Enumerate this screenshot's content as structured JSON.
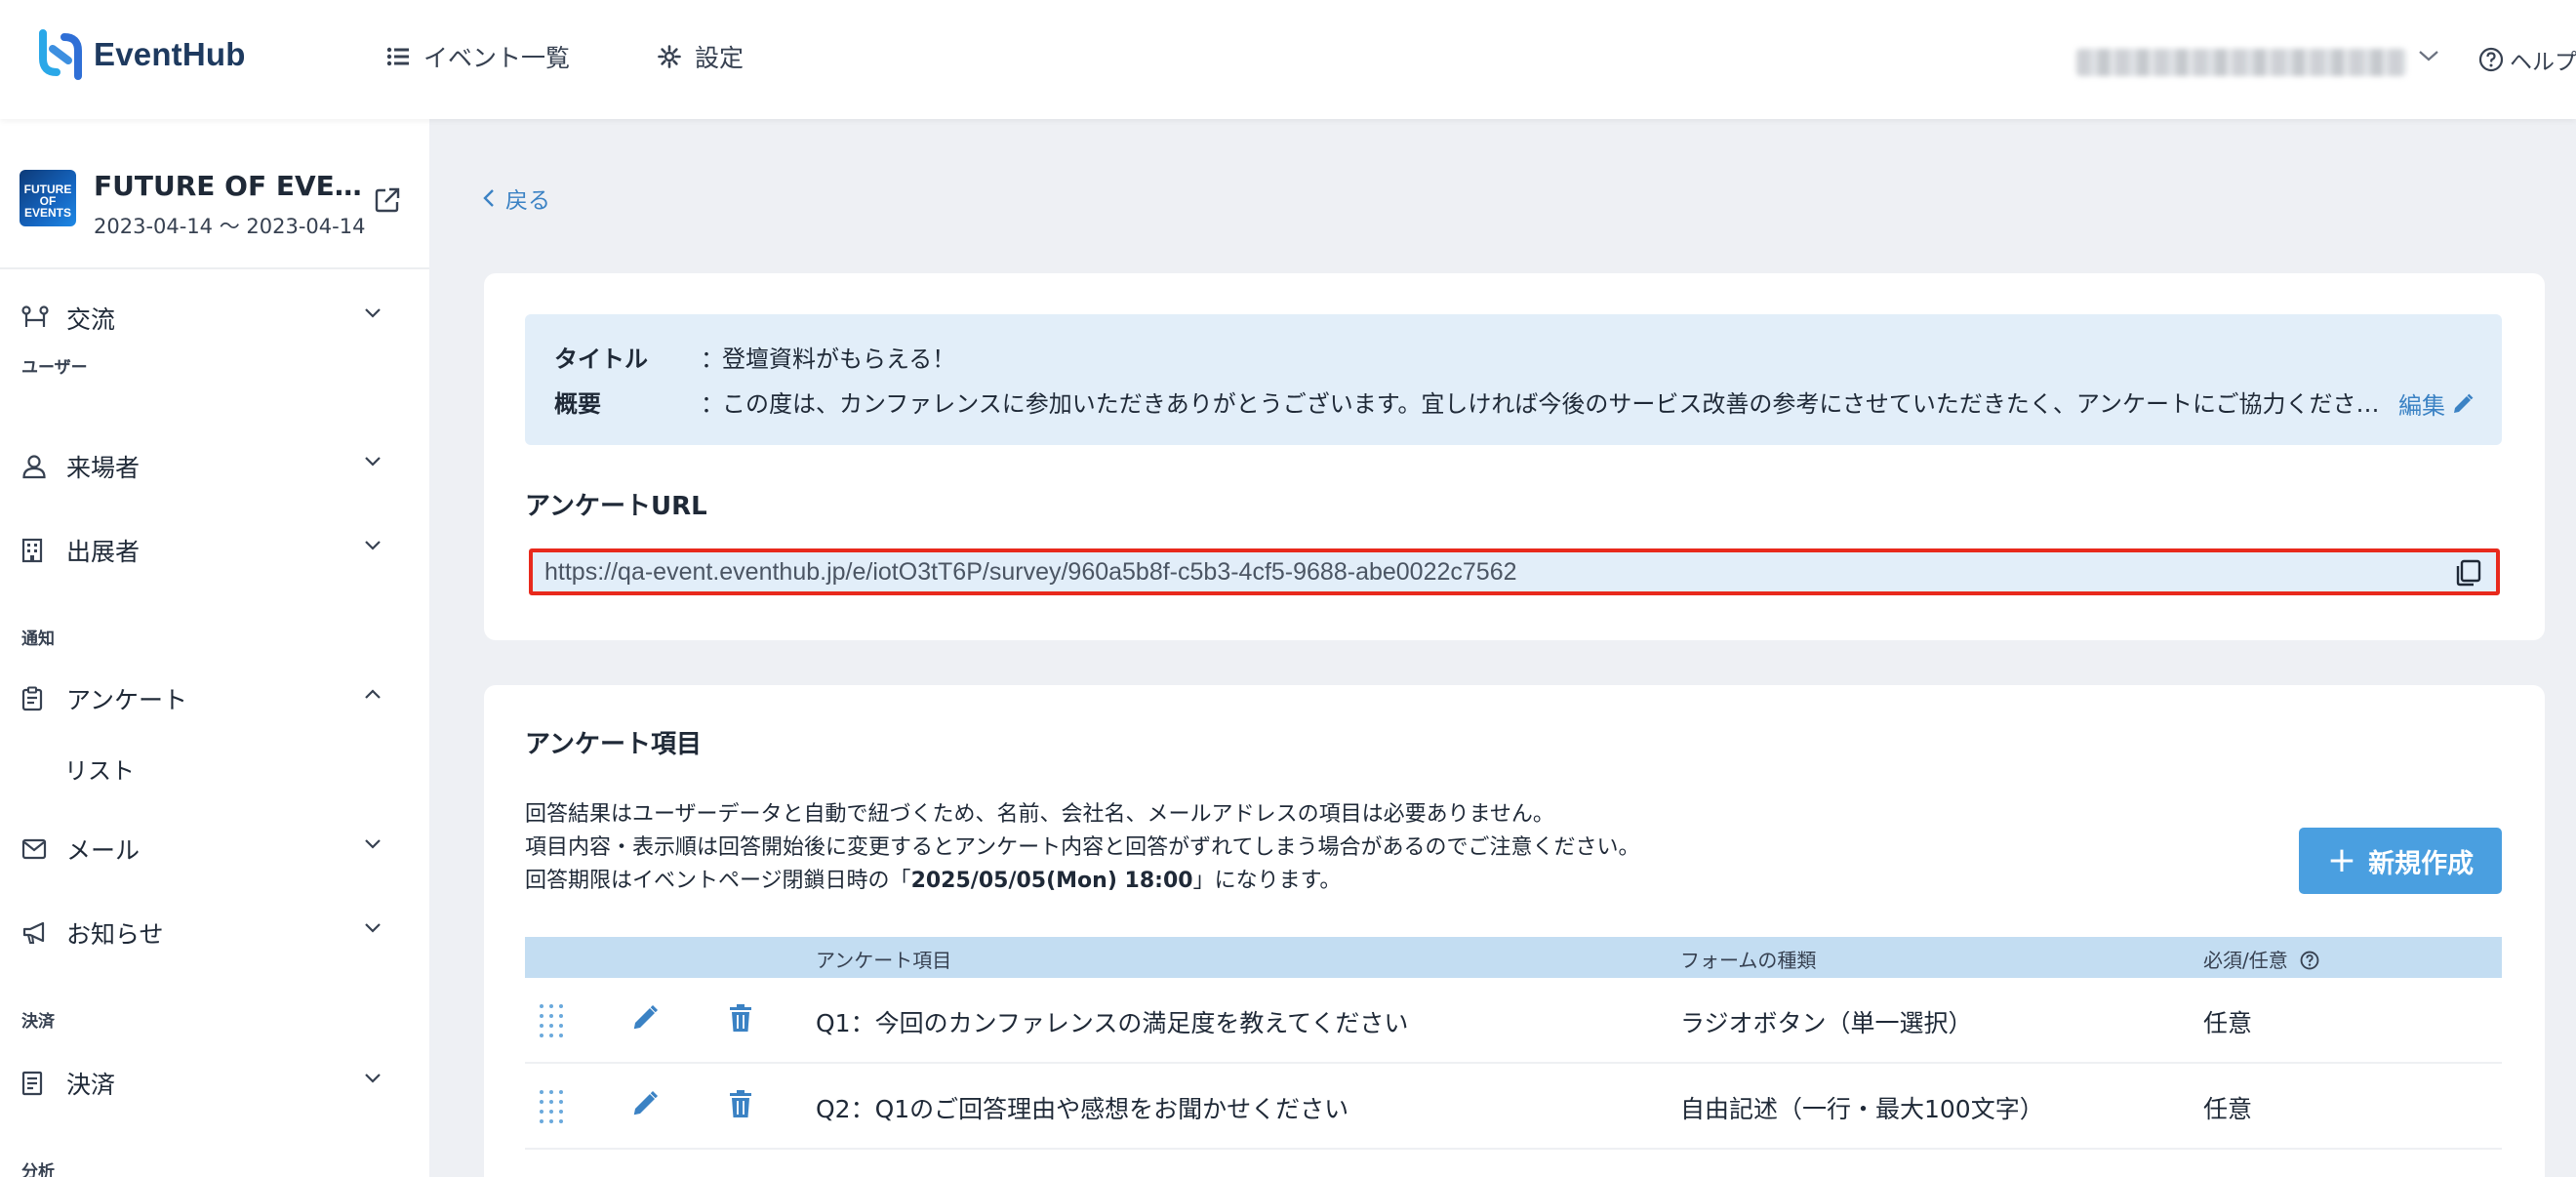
{
  "header": {
    "logo_text": "EventHub",
    "nav": [
      {
        "label": "イベント一覧",
        "icon": "list-icon"
      },
      {
        "label": "設定",
        "icon": "gear-icon"
      }
    ],
    "help_label": "ヘルプ"
  },
  "sidebar": {
    "event": {
      "thumb_text": "FUTURE OF EVENTS",
      "title": "FUTURE OF EVENTS",
      "dates": "2023-04-14 〜 2023-04-14"
    },
    "items": [
      {
        "label": "交流",
        "icon": "network-icon",
        "expanded": false
      },
      {
        "section": "ユーザー"
      },
      {
        "label": "来場者",
        "icon": "person-icon",
        "expanded": false
      },
      {
        "label": "出展者",
        "icon": "building-icon",
        "expanded": false
      },
      {
        "section": "通知"
      },
      {
        "label": "アンケート",
        "icon": "clipboard-icon",
        "expanded": true,
        "sub": [
          "リスト"
        ]
      },
      {
        "label": "メール",
        "icon": "mail-icon",
        "expanded": false
      },
      {
        "label": "お知らせ",
        "icon": "megaphone-icon",
        "expanded": false
      },
      {
        "section": "決済"
      },
      {
        "label": "決済",
        "icon": "receipt-icon",
        "expanded": false
      },
      {
        "section": "分析"
      }
    ]
  },
  "main": {
    "back_label": "戻る",
    "survey": {
      "title_key": "タイトル",
      "title_value": "登壇資料がもらえる！",
      "summary_key": "概要",
      "summary_value": "この度は、カンファレンスに参加いただきありがとうございます。宜しければ今後のサービス改善の参考にさせていただきたく、アンケートにご協力ください。",
      "colon": "：",
      "edit_label": "編集"
    },
    "url": {
      "heading": "アンケートURL",
      "value": "https://qa-event.eventhub.jp/e/iotO3tT6P/survey/960a5b8f-c5b3-4cf5-9688-abe0022c7562"
    },
    "items": {
      "heading": "アンケート項目",
      "notes": [
        "回答結果はユーザーデータと自動で紐づくため、名前、会社名、メールアドレスの項目は必要ありません。",
        "項目内容・表示順は回答開始後に変更するとアンケート内容と回答がずれてしまう場合があるのでご注意ください。"
      ],
      "deadline_prefix": "回答期限はイベントページ閉鎖日時の「",
      "deadline_value": "2025/05/05(Mon) 18:00",
      "deadline_suffix": "」になります。",
      "new_button": "新規作成",
      "columns": {
        "item": "アンケート項目",
        "form": "フォームの種類",
        "required": "必須/任意"
      },
      "rows": [
        {
          "item": "Q1：今回のカンファレンスの満足度を教えてください",
          "form": "ラジオボタン（単一選択）",
          "required": "任意"
        },
        {
          "item": "Q2：Q1のご回答理由や感想をお聞かせください",
          "form": "自由記述（一行・最大100文字）",
          "required": "任意"
        }
      ]
    }
  },
  "colors": {
    "accent": "#3b82c4",
    "button": "#4a9fe0",
    "highlight_border": "#e8291c",
    "info_bg": "#e2eef9",
    "table_header": "#c3ddf2"
  }
}
